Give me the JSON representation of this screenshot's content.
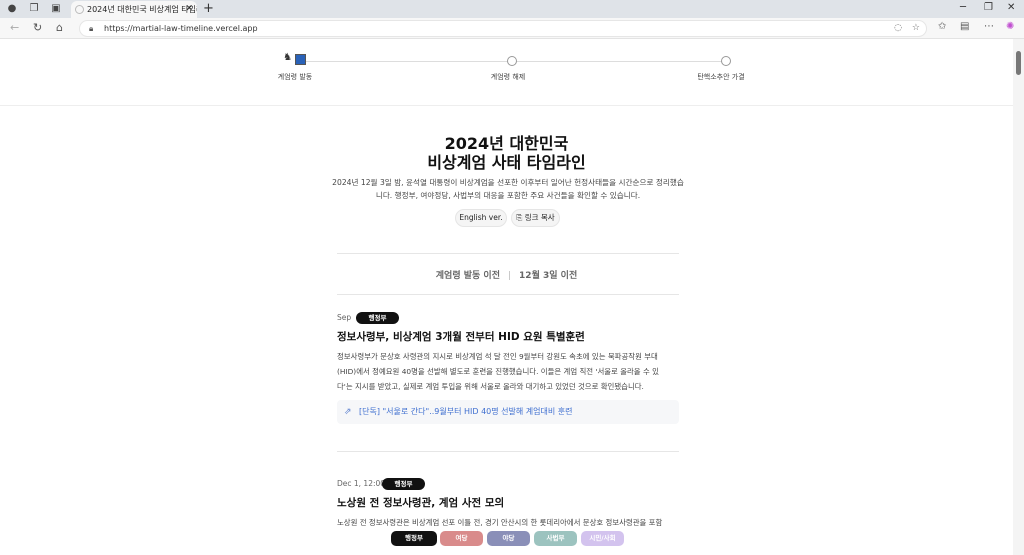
{
  "browser": {
    "tab_title": "2024년 대한민국 비상계엄 타임라인",
    "url": "https://martial-law-timeline.vercel.app"
  },
  "progress": {
    "steps": [
      {
        "label": "계엄령 발동"
      },
      {
        "label": "계엄령 해제"
      },
      {
        "label": "탄핵소추안 가결"
      }
    ]
  },
  "hero": {
    "title_line1": "2024년 대한민국",
    "title_line2": "비상계엄 사태 타임라인",
    "desc_line1": "2024년 12월 3일 밤, 윤석열 대통령이 비상계엄을 선포한 이후부터 일어난 헌정사태들을 시간순으로 정리했습",
    "desc_line2": "니다. 행정부, 여야정당, 사법부의 대응을 포함한 주요 사건들을 확인할 수 있습니다.",
    "english_btn": "English ver.",
    "copy_btn": "링크 복사"
  },
  "section": {
    "title": "계엄령 발동 이전",
    "subtitle": "12월 3일 이전"
  },
  "events": [
    {
      "date": "Sep",
      "badge": "행정부",
      "title": "정보사령부, 비상계엄 3개월 전부터 HID 요원 특별훈련",
      "body_line1": "정보사령부가 문상호 사령관의 지시로 비상계엄 석 달 전인 9월부터 강원도 속초에 있는 북파공작원 부대",
      "body_line2": "(HID)에서 정예요원 40명을 선발해 별도로 훈련을 진행했습니다. 이들은 계엄 직전 '서울로 올라올 수 있",
      "body_line3": "다'는 지시를 받았고, 실제로 계엄 투입을 위해 서울로 올라와 대기하고 있었던 것으로 확인됐습니다.",
      "link": "[단독] \"서울로 간다\"..9월부터 HID 40명 선발해 계엄대비 훈련"
    },
    {
      "date": "Dec 1, 12:00",
      "badge": "행정부",
      "title": "노상원 전 정보사령관, 계엄 사전 모의",
      "body_line1": "노상원 전 정보사령관은 비상계엄 선포 이틀 전, 경기 안산시의 한 롯데리아에서 문상호 정보사령관을 포함"
    }
  ],
  "filters": [
    {
      "label": "행정부",
      "color": "#111111"
    },
    {
      "label": "여당",
      "color": "#d98b8b"
    },
    {
      "label": "야당",
      "color": "#8a8fb8"
    },
    {
      "label": "사법부",
      "color": "#9cc3bf"
    },
    {
      "label": "시민/사회",
      "color": "#d3c3ee"
    }
  ]
}
